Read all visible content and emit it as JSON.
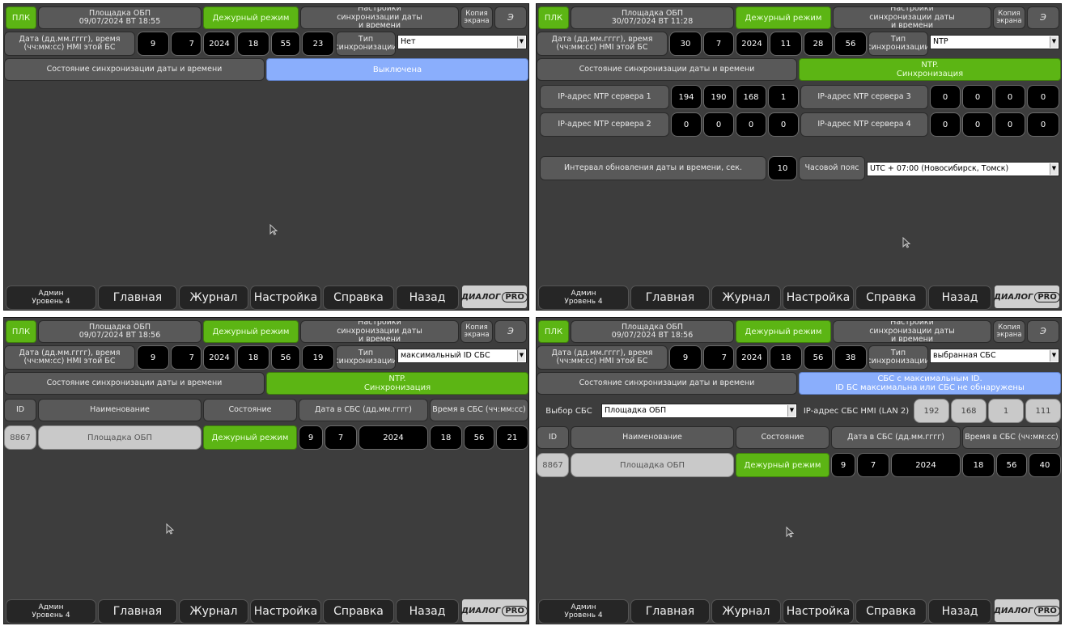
{
  "common": {
    "plc": "ПЛК",
    "duty_mode": "Дежурный режим",
    "sync_settings": "Настройки синхронизации даты и времени",
    "screen_copy": "Копия экрана",
    "e_btn": "Э",
    "date_label": "Дата (дд.мм.гггг), время (чч:мм:сс) HMI этой БС",
    "sync_type_label": "Тип синхронизации",
    "sync_state_label": "Состояние синхронизации даты и времени",
    "nav": {
      "admin": "Админ",
      "level": "Уровень 4",
      "main": "Главная",
      "journal": "Журнал",
      "settings": "Настройка",
      "help": "Справка",
      "back": "Назад"
    },
    "logo": {
      "text": "ДИАЛОГ",
      "pro": "PRO"
    },
    "colors": {
      "green": "#5cb514",
      "blue": "#8aaefc",
      "bg": "#3d3d3d",
      "black": "#000000"
    }
  },
  "panels": [
    {
      "site": "Площадка ОБП",
      "datetime": "09/07/2024 ВТ 18:55",
      "date": {
        "d": "9",
        "m": "7",
        "y": "2024",
        "h": "18",
        "min": "55",
        "s": "23"
      },
      "sync_type": "Нет",
      "status": "Выключена"
    },
    {
      "site": "Площадка ОБП",
      "datetime": "30/07/2024 ВТ 11:28",
      "date": {
        "d": "30",
        "m": "7",
        "y": "2024",
        "h": "11",
        "min": "28",
        "s": "56"
      },
      "sync_type": "NTP",
      "status_line1": "NTP.",
      "status_line2": "Синхронизация",
      "ntp1_label": "IP-адрес NTP сервера 1",
      "ntp1": [
        "194",
        "190",
        "168",
        "1"
      ],
      "ntp2_label": "IP-адрес NTP сервера 2",
      "ntp2": [
        "0",
        "0",
        "0",
        "0"
      ],
      "ntp3_label": "IP-адрес NTP сервера 3",
      "ntp3": [
        "0",
        "0",
        "0",
        "0"
      ],
      "ntp4_label": "IP-адрес NTP сервера 4",
      "ntp4": [
        "0",
        "0",
        "0",
        "0"
      ],
      "interval_label": "Интервал обновления даты и времени, сек.",
      "interval": "10",
      "tz_label": "Часовой пояс",
      "tz": "UTC + 07:00 (Новосибирск, Томск)"
    },
    {
      "site": "Площадка ОБП",
      "datetime": "09/07/2024 ВТ 18:56",
      "date": {
        "d": "9",
        "m": "7",
        "y": "2024",
        "h": "18",
        "min": "56",
        "s": "19"
      },
      "sync_type": "максимальный ID СБС",
      "status_line1": "NTP.",
      "status_line2": "Синхронизация",
      "table": {
        "headers": [
          "ID",
          "Наименование",
          "Состояние",
          "Дата в СБС (дд.мм.гггг)",
          "Время в СБС (чч:мм:сс)"
        ],
        "row": {
          "id": "8867",
          "name": "Площадка ОБП",
          "state": "Дежурный режим",
          "d": "9",
          "m": "7",
          "y": "2024",
          "h": "18",
          "min": "56",
          "s": "21"
        }
      }
    },
    {
      "site": "Площадка ОБП",
      "datetime": "09/07/2024 ВТ 18:56",
      "date": {
        "d": "9",
        "m": "7",
        "y": "2024",
        "h": "18",
        "min": "56",
        "s": "38"
      },
      "sync_type": "выбранная СБС",
      "status_line1": "СБС с максимальным ID.",
      "status_line2": "ID БС максимальна или СБС не обнаружены",
      "sbs_select_label": "Выбор СБС",
      "sbs_select": "Площадка ОБП",
      "sbs_ip_label": "IP-адрес СБС HMI (LAN 2)",
      "sbs_ip": [
        "192",
        "168",
        "1",
        "111"
      ],
      "table": {
        "headers": [
          "ID",
          "Наименование",
          "Состояние",
          "Дата в СБС (дд.мм.гггг)",
          "Время в СБС (чч:мм:сс)"
        ],
        "row": {
          "id": "8867",
          "name": "Площадка ОБП",
          "state": "Дежурный режим",
          "d": "9",
          "m": "7",
          "y": "2024",
          "h": "18",
          "min": "56",
          "s": "40"
        }
      }
    }
  ]
}
